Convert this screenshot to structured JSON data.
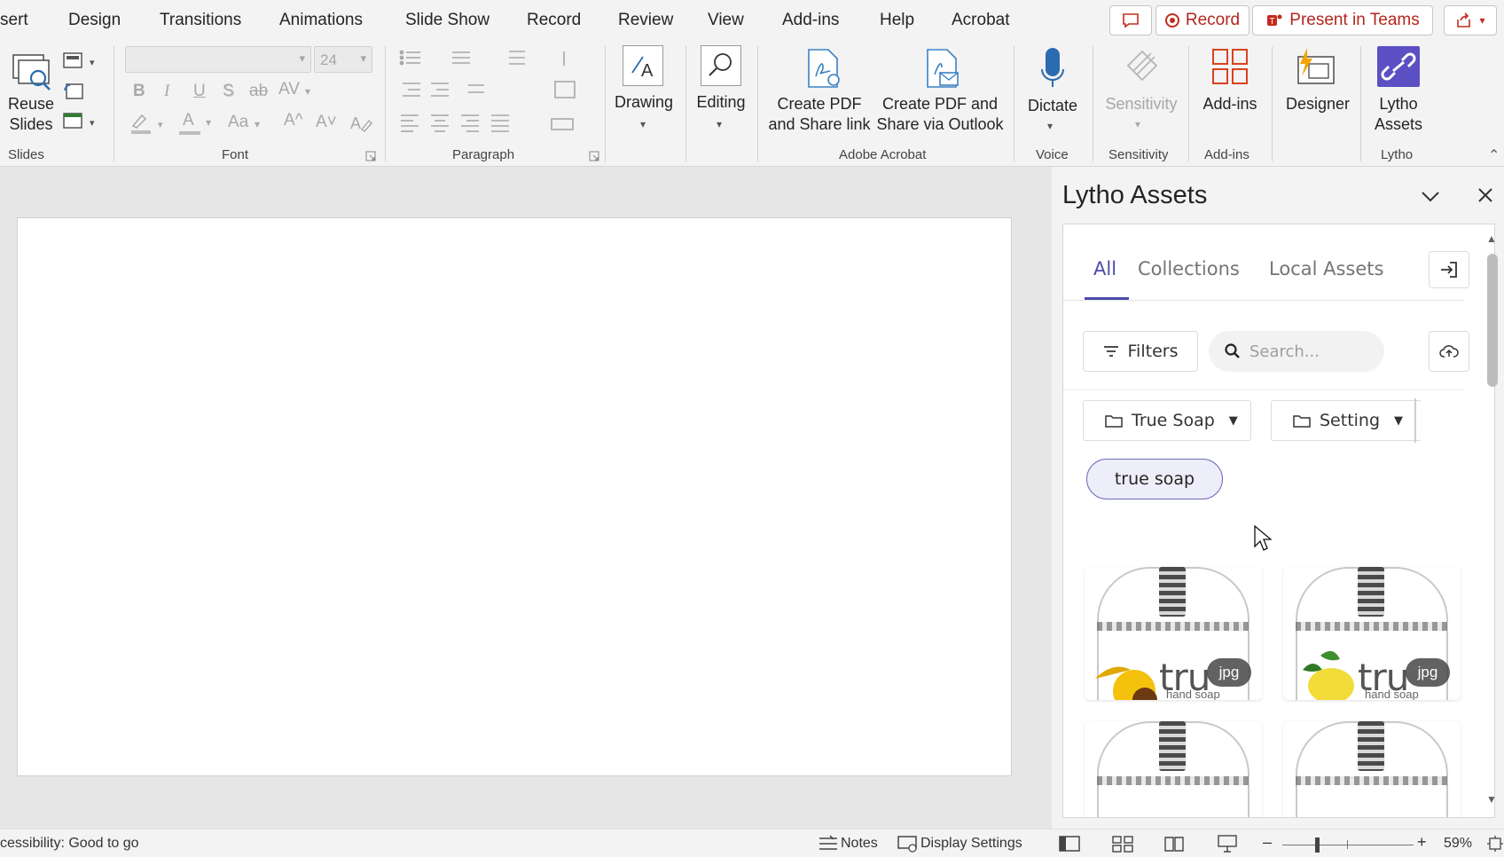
{
  "menu": {
    "tabs": [
      "sert",
      "Design",
      "Transitions",
      "Animations",
      "Slide Show",
      "Record",
      "Review",
      "View",
      "Add-ins",
      "Help",
      "Acrobat"
    ],
    "record_label": "Record",
    "present_label": "Present in Teams"
  },
  "ribbon": {
    "slides": {
      "reuse_label": "Reuse\nSlides",
      "group": "Slides"
    },
    "font": {
      "size_value": "24",
      "group": "Font",
      "bold": "B",
      "italic": "I",
      "underline": "U",
      "shadow": "S",
      "strike": "ab",
      "spacing": "AV",
      "color_a": "A",
      "case": "Aa",
      "grow": "A^",
      "shrink": "A˅"
    },
    "paragraph": {
      "group": "Paragraph"
    },
    "drawing": {
      "label": "Drawing"
    },
    "editing": {
      "label": "Editing"
    },
    "acrobat": {
      "create_pdf_label": "Create PDF\nand Share link",
      "create_pdf_outlook_label": "Create PDF and\nShare via Outlook",
      "group": "Adobe Acrobat"
    },
    "voice": {
      "dictate_label": "Dictate",
      "group": "Voice"
    },
    "sensitivity": {
      "label": "Sensitivity",
      "group": "Sensitivity"
    },
    "addins": {
      "label": "Add-ins",
      "group": "Add-ins"
    },
    "designer": {
      "label": "Designer"
    },
    "lytho": {
      "label": "Lytho\nAssets",
      "group": "Lytho"
    }
  },
  "pane": {
    "title": "Lytho Assets",
    "tabs": [
      "All",
      "Collections",
      "Local Assets"
    ],
    "filters_label": "Filters",
    "search_placeholder": "Search...",
    "folders": [
      "True Soap",
      "Setting"
    ],
    "chip_label": "true soap",
    "thumbnails": [
      {
        "brand": "tru",
        "sub": "hand soap",
        "ext": "jpg",
        "flower": "sunflower"
      },
      {
        "brand": "tru",
        "sub": "hand soap",
        "ext": "jpg",
        "flower": "lemon"
      }
    ]
  },
  "status": {
    "accessibility": "cessibility: Good to go",
    "notes_label": "Notes",
    "display_settings_label": "Display Settings",
    "zoom": "59%"
  },
  "colors": {
    "accent": "#4b4bab",
    "record_red": "#c42b1c",
    "teams_red": "#b3261e"
  }
}
